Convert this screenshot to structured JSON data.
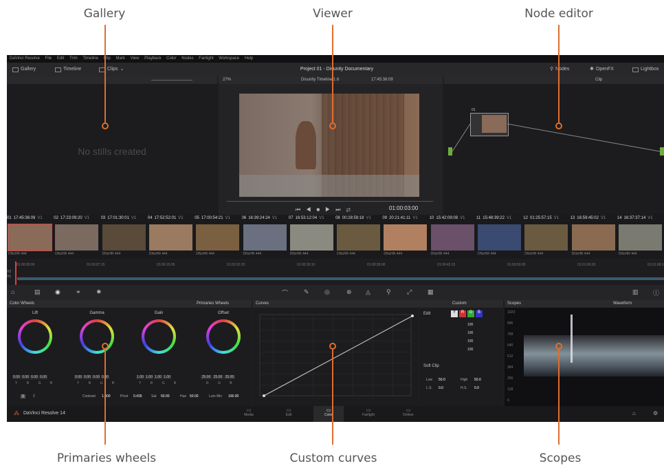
{
  "callouts": {
    "gallery": "Gallery",
    "viewer": "Viewer",
    "node_editor": "Node editor",
    "primaries": "Primaries wheels",
    "curves": "Custom curves",
    "scopes": "Scopes"
  },
  "app": {
    "menu": [
      "DaVinci Resolve",
      "File",
      "Edit",
      "Trim",
      "Timeline",
      "Clip",
      "Mark",
      "View",
      "Playback",
      "Color",
      "Nodes",
      "Fairlight",
      "Workspace",
      "Help"
    ],
    "toolbar": {
      "gallery": "Gallery",
      "timeline": "Timeline",
      "clips": "Clips",
      "project_title": "Project 01 - Disunity Documentary",
      "nodes": "Nodes",
      "openfx": "OpenFX",
      "lightbox": "Lightbox"
    },
    "viewer_bar": {
      "zoom": "27%",
      "timeline_name": "Disunity Timeline 1.6",
      "timecode": "17:45:36:09",
      "clip_label": "Clip"
    },
    "gallery_empty": "No stills created",
    "viewer_timecode": "01:00:03:00",
    "node_label": "01",
    "clips": [
      {
        "num": "01",
        "tc": "17:45:36:09",
        "track": "V1",
        "codec": "DNxHR 444"
      },
      {
        "num": "02",
        "tc": "17:23:09:20",
        "track": "V1",
        "codec": "DNxHR 444"
      },
      {
        "num": "03",
        "tc": "17:01:30:01",
        "track": "V1",
        "codec": "DNxHR 444"
      },
      {
        "num": "04",
        "tc": "17:52:52:01",
        "track": "V1",
        "codec": "DNxHR 444"
      },
      {
        "num": "05",
        "tc": "17:00:54:21",
        "track": "V1",
        "codec": "DNxHR 444"
      },
      {
        "num": "06",
        "tc": "16:39:24:24",
        "track": "V1",
        "codec": "DNxHR 444"
      },
      {
        "num": "07",
        "tc": "16:53:12:04",
        "track": "V1",
        "codec": "DNxHR 444"
      },
      {
        "num": "08",
        "tc": "00:28:59:18",
        "track": "V1",
        "codec": "DNxHR 444"
      },
      {
        "num": "09",
        "tc": "20:21:41:11",
        "track": "V1",
        "codec": "DNxHR 444"
      },
      {
        "num": "10",
        "tc": "15:42:09:08",
        "track": "V1",
        "codec": "DNxHR 444"
      },
      {
        "num": "11",
        "tc": "15:48:39:22",
        "track": "V1",
        "codec": "DNxHR 444"
      },
      {
        "num": "12",
        "tc": "01:25:57:15",
        "track": "V1",
        "codec": "DNxHR 444"
      },
      {
        "num": "13",
        "tc": "16:59:45:02",
        "track": "V1",
        "codec": "DNxHR 444"
      },
      {
        "num": "14",
        "tc": "16:37:37:14",
        "track": "V1",
        "codec": "DNxHR 444"
      }
    ],
    "clip_colors": [
      "#8a6a58",
      "#7a6a60",
      "#5a4a3a",
      "#9a7a60",
      "#7a6040",
      "#6a7080",
      "#8a8a80",
      "#6a5a40",
      "#b08060",
      "#6a5068",
      "#3a4a70",
      "#6a5a40",
      "#8a6a50",
      "#7a7a70"
    ],
    "ruler": [
      "01:00:00:00",
      "01:00:07:15",
      "01:00:15:05",
      "01:00:22:20",
      "01:00:30:10",
      "01:00:38:00",
      "01:00:45:15",
      "01:00:53:05",
      "01:01:00:20",
      "01:01:08:10"
    ],
    "track_labels": [
      "V2",
      "V1"
    ],
    "color_wheels": {
      "title": "Color Wheels",
      "mode": "Primaries Wheels",
      "wheels": [
        {
          "name": "Lift",
          "values": [
            "0.00",
            "0.00",
            "0.00",
            "0.00"
          ]
        },
        {
          "name": "Gamma",
          "values": [
            "0.00",
            "0.00",
            "0.00",
            "0.00"
          ]
        },
        {
          "name": "Gain",
          "values": [
            "1.00",
            "1.00",
            "1.00",
            "1.00"
          ]
        },
        {
          "name": "Offset",
          "values": [
            "25.00",
            "25.00",
            "25.00"
          ]
        }
      ],
      "channels": "Y R G B",
      "offset_channels": "R G B",
      "footer": {
        "page": "1",
        "page2": "2",
        "contrast_label": "Contrast",
        "contrast": "1.000",
        "pivot_label": "Pivot",
        "pivot": "0.435",
        "sat_label": "Sat",
        "sat": "50.00",
        "hue_label": "Hue",
        "hue": "50.00",
        "lummix_label": "Lum Mix",
        "lummix": "100.00"
      }
    },
    "curves": {
      "title": "Curves",
      "mode": "Custom",
      "edit_label": "Edit",
      "channels": [
        "Y",
        "R",
        "G",
        "B"
      ],
      "intensities": [
        "100",
        "100",
        "100",
        "100"
      ],
      "softclip": "Soft Clip",
      "low_label": "Low",
      "low": "50.0",
      "high_label": "High",
      "high": "50.0",
      "ls_label": "L.S.",
      "ls": "0.0",
      "hs_label": "H.S.",
      "hs": "0.0"
    },
    "scopes": {
      "title": "Scopes",
      "mode": "Waveform",
      "scale": [
        "1023",
        "896",
        "768",
        "640",
        "512",
        "384",
        "256",
        "128",
        "0"
      ]
    },
    "pages": [
      "Media",
      "Edit",
      "Color",
      "Fairlight",
      "Deliver"
    ],
    "active_page": "Color",
    "brand": "DaVinci Resolve 14"
  }
}
